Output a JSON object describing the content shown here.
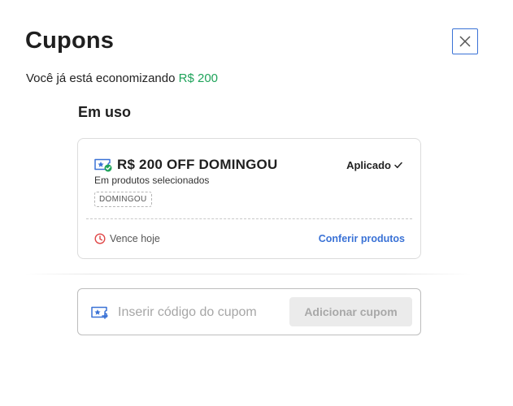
{
  "header": {
    "title": "Cupons",
    "close_icon": "close-icon"
  },
  "savings": {
    "prefix": "Você já está economizando",
    "amount": "R$ 200",
    "amount_color": "#1fa35a"
  },
  "in_use": {
    "section_title": "Em uso",
    "coupon": {
      "icon": "coupon-applied-icon",
      "name": "R$ 200 OFF DOMINGOU",
      "status": "Aplicado",
      "status_icon": "checkmark-icon",
      "description": "Em produtos selecionados",
      "code": "DOMINGOU",
      "expiry_icon": "clock-icon",
      "expiry": "Vence hoje",
      "link": "Conferir produtos"
    }
  },
  "add_coupon": {
    "icon": "coupon-add-icon",
    "placeholder": "Inserir código do cupom",
    "value": "",
    "button_label": "Adicionar cupom"
  },
  "colors": {
    "accent": "#3a72d6",
    "success": "#1fa35a",
    "danger": "#e04848"
  }
}
